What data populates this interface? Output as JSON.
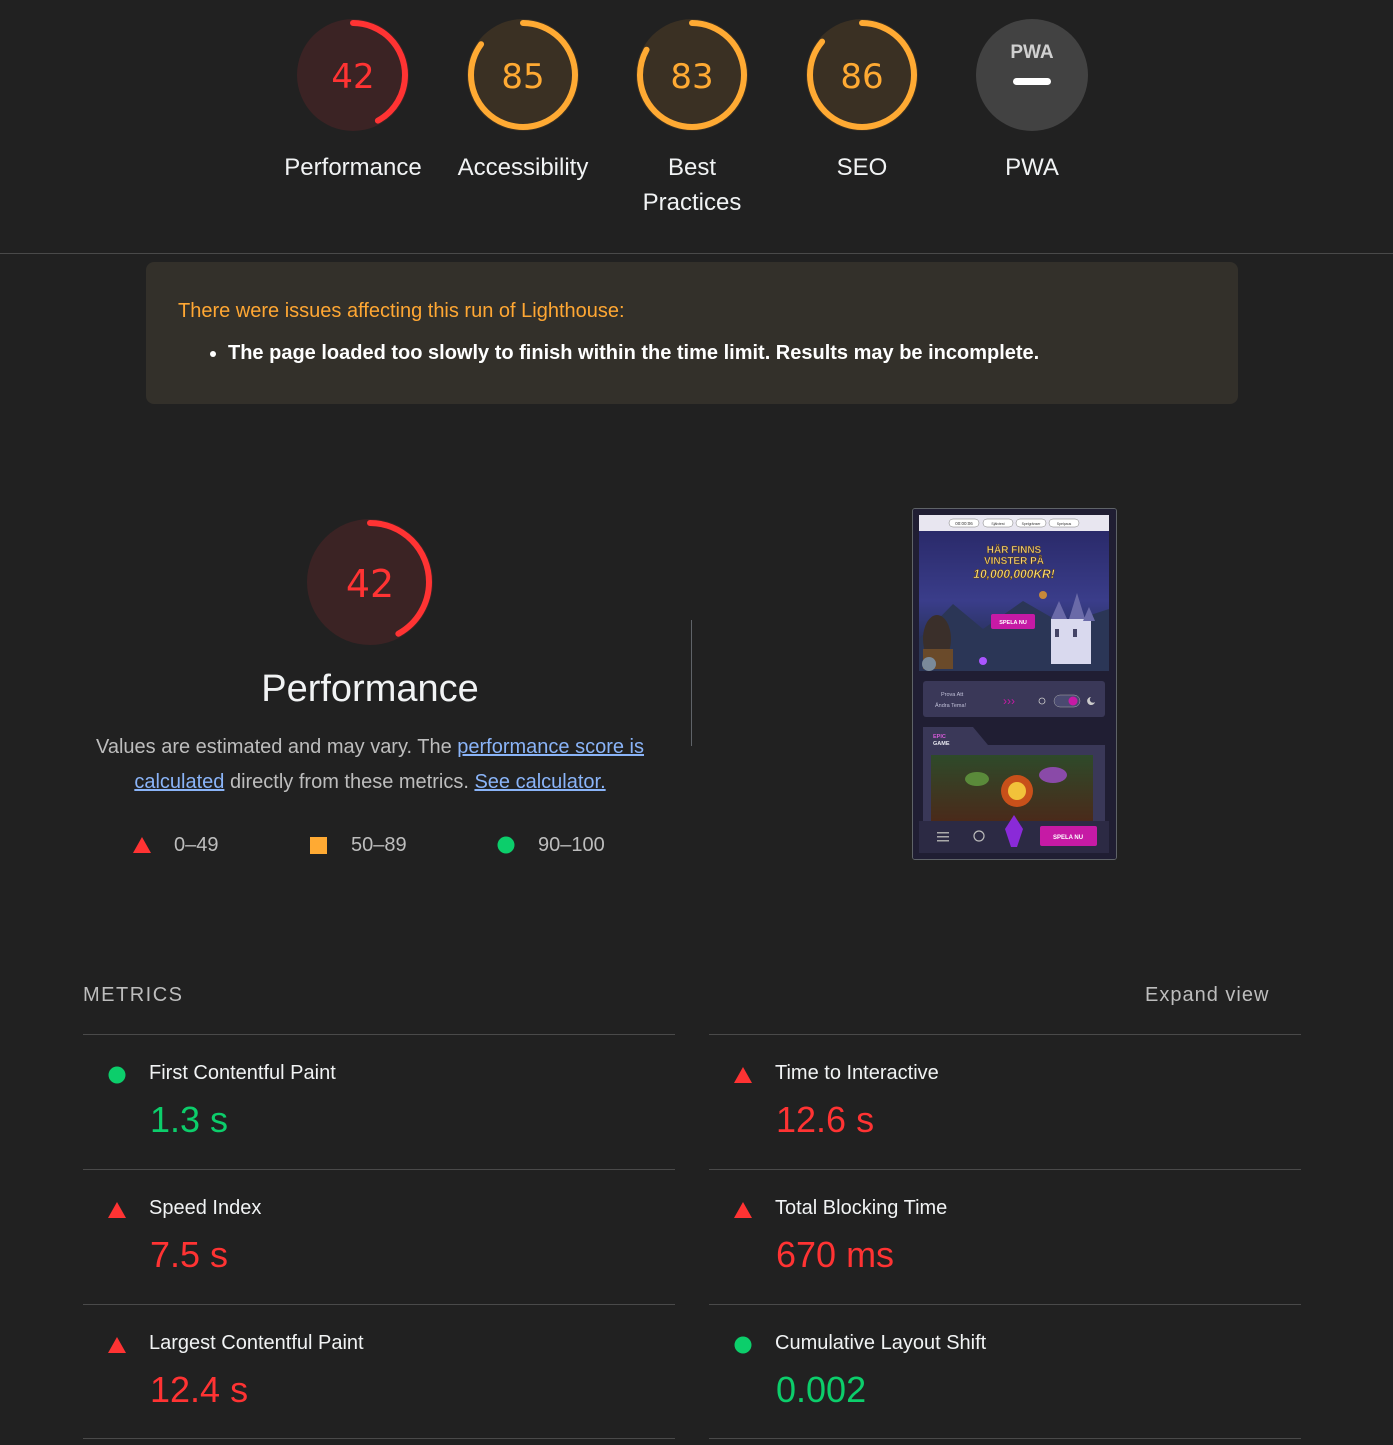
{
  "scores": [
    {
      "value": "42",
      "label": "Performance",
      "fraction": 0.42,
      "color": "#ff3333",
      "bg": "#3b2324"
    },
    {
      "value": "85",
      "label": "Accessibility",
      "fraction": 0.85,
      "color": "#ffaa33",
      "bg": "#3a3023"
    },
    {
      "value": "83",
      "label": "Best Practices",
      "fraction": 0.83,
      "color": "#ffaa33",
      "bg": "#3a3023"
    },
    {
      "value": "86",
      "label": "SEO",
      "fraction": 0.86,
      "color": "#ffaa33",
      "bg": "#3a3023"
    },
    {
      "value": "—",
      "label": "PWA",
      "badge": "PWA"
    }
  ],
  "warning": {
    "title": "There were issues affecting this run of Lighthouse:",
    "items": [
      "The page loaded too slowly to finish within the time limit. Results may be incomplete."
    ]
  },
  "performance": {
    "score": "42",
    "fraction": 0.42,
    "title": "Performance",
    "desc_1": "Values are estimated and may vary. The ",
    "link_1": "performance score is calculated",
    "desc_2": " directly from these metrics. ",
    "link_2": "See calculator."
  },
  "legend": [
    {
      "icon": "triangle-red-icon",
      "range": "0–49"
    },
    {
      "icon": "square-orange-icon",
      "range": "50–89"
    },
    {
      "icon": "circle-green-icon",
      "range": "90–100"
    }
  ],
  "screenshot": {
    "timer": "00:00:06",
    "chip_1": "Spelpaus",
    "chip_2": "Spelgränser",
    "chip_3": "Självtest",
    "headline_1": "HÄR FINNS",
    "headline_2": "VINSTER PÅ",
    "headline_3": "10,000,000KR!",
    "cta": "SPELA NU",
    "theme_text_1": "Prova Att",
    "theme_text_2": "Ändra Tema!",
    "epic_1": "EPIC",
    "epic_2": "GAME",
    "bottom_cta": "SPELA NU"
  },
  "metrics": {
    "header": "METRICS",
    "expand": "Expand view",
    "items": [
      {
        "name": "First Contentful Paint",
        "value": "1.3 s",
        "status": "pass"
      },
      {
        "name": "Time to Interactive",
        "value": "12.6 s",
        "status": "fail"
      },
      {
        "name": "Speed Index",
        "value": "7.5 s",
        "status": "fail"
      },
      {
        "name": "Total Blocking Time",
        "value": "670 ms",
        "status": "fail"
      },
      {
        "name": "Largest Contentful Paint",
        "value": "12.4 s",
        "status": "fail"
      },
      {
        "name": "Cumulative Layout Shift",
        "value": "0.002",
        "status": "pass"
      }
    ]
  }
}
